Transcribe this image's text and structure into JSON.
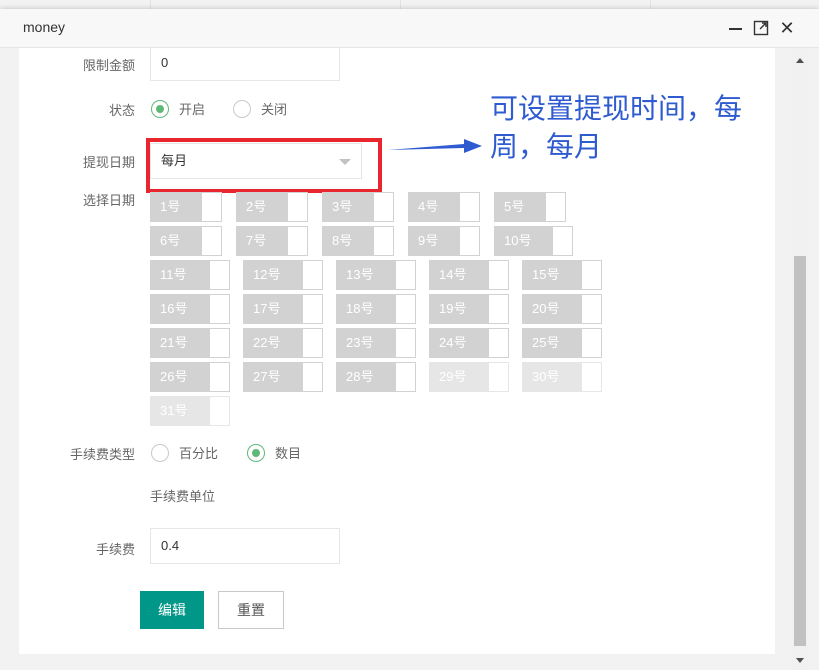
{
  "window": {
    "title": "money"
  },
  "background_table": {
    "headers": [
      "",
      "",
      "",
      ""
    ]
  },
  "form": {
    "limit_amount": {
      "label": "限制金额",
      "value": "0"
    },
    "status": {
      "label": "状态",
      "options": [
        {
          "label": "开启",
          "checked": true
        },
        {
          "label": "关闭",
          "checked": false
        }
      ]
    },
    "withdraw_date": {
      "label": "提现日期",
      "value": "每月"
    },
    "select_date": {
      "label": "选择日期",
      "days": [
        "1号",
        "2号",
        "3号",
        "4号",
        "5号",
        "6号",
        "7号",
        "8号",
        "9号",
        "10号",
        "11号",
        "12号",
        "13号",
        "14号",
        "15号",
        "16号",
        "17号",
        "18号",
        "19号",
        "20号",
        "21号",
        "22号",
        "23号",
        "24号",
        "25号",
        "26号",
        "27号",
        "28号",
        "29号",
        "30号",
        "31号"
      ]
    },
    "fee_type": {
      "label": "手续费类型",
      "options": [
        {
          "label": "百分比",
          "checked": false
        },
        {
          "label": "数目",
          "checked": true
        }
      ],
      "unit_hint": "手续费单位"
    },
    "fee": {
      "label": "手续费",
      "value": "0.4"
    },
    "buttons": {
      "edit": "编辑",
      "reset": "重置"
    }
  },
  "annotation": {
    "text": "可设置提现时间，每周，每月"
  },
  "colors": {
    "accent": "#009688",
    "radio_on": "#5fb878",
    "highlight": "#e8262e",
    "annotation": "#2f5bd0"
  },
  "icons": {
    "minimize": "minimize-icon",
    "maximize": "maximize-icon",
    "close": "close-icon"
  }
}
